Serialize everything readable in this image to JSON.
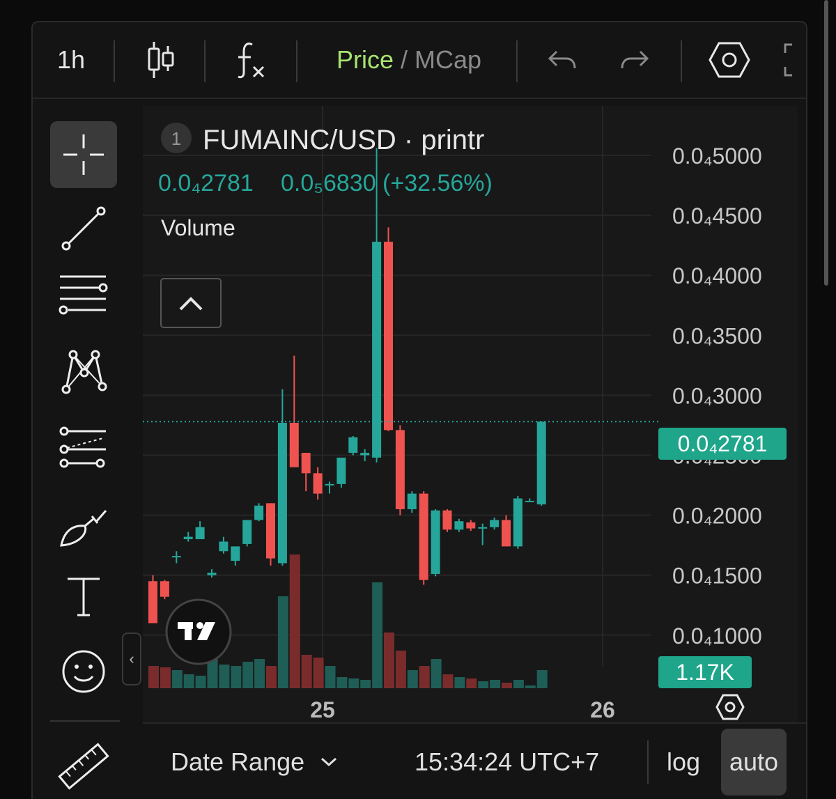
{
  "toolbar": {
    "interval": "1h",
    "price_label": "Price",
    "separator": "/",
    "mcap_label": "MCap",
    "icons": [
      "candles-icon",
      "indicators-fx-icon",
      "undo-icon",
      "redo-icon",
      "settings-hexagon-icon",
      "fullscreen-icon"
    ]
  },
  "left_tools": [
    "crosshair-icon",
    "trend-line-icon",
    "horizontal-lines-icon",
    "pattern-icon",
    "forecast-icon",
    "brush-icon",
    "text-icon",
    "emoji-icon",
    "ruler-icon"
  ],
  "legend": {
    "index": "1",
    "symbol": "FUMAINC/USD · printr",
    "price": "0.0₄2781",
    "change": "0.0₅6830 (+32.56%)",
    "volume_label": "Volume"
  },
  "price_axis": {
    "labels": [
      "0.0₄5000",
      "0.0₄4500",
      "0.0₄4000",
      "0.0₄3500",
      "0.0₄3000",
      "0.0₄2500",
      "0.0₄2000",
      "0.0₄1500",
      "0.0₄1000"
    ],
    "current_price_badge": "0.0₄2781",
    "volume_badge": "1.17K"
  },
  "time_axis": {
    "labels": [
      "25",
      "26"
    ]
  },
  "bottom_bar": {
    "date_range": "Date Range",
    "clock": "15:34:24 UTC+7",
    "log": "log",
    "auto": "auto"
  },
  "colors": {
    "up": "#26a69a",
    "down": "#ef5350",
    "up_vol": "#1f5e56",
    "down_vol": "#7a2c2c",
    "price_label_green": "#a7e46f"
  },
  "chart_data": {
    "type": "candlestick",
    "unit_note": "prices in units of 1e-5 USD (0.0₄2500 = 2.5)",
    "ylim": [
      0.78,
      5.3
    ],
    "candles": [
      {
        "o": 1.45,
        "h": 1.5,
        "l": 1.1,
        "c": 1.1
      },
      {
        "o": 1.45,
        "h": 1.46,
        "l": 1.3,
        "c": 1.32
      },
      {
        "o": 1.66,
        "h": 1.7,
        "l": 1.6,
        "c": 1.66
      },
      {
        "o": 1.8,
        "h": 1.86,
        "l": 1.78,
        "c": 1.82
      },
      {
        "o": 1.8,
        "h": 1.95,
        "l": 1.8,
        "c": 1.9
      },
      {
        "o": 1.5,
        "h": 1.55,
        "l": 1.48,
        "c": 1.52
      },
      {
        "o": 1.7,
        "h": 1.82,
        "l": 1.68,
        "c": 1.78
      },
      {
        "o": 1.62,
        "h": 1.72,
        "l": 1.58,
        "c": 1.74
      },
      {
        "o": 1.76,
        "h": 1.96,
        "l": 1.74,
        "c": 1.96
      },
      {
        "o": 1.96,
        "h": 2.1,
        "l": 1.95,
        "c": 2.08
      },
      {
        "o": 2.1,
        "h": 2.1,
        "l": 1.58,
        "c": 1.64
      },
      {
        "o": 1.6,
        "h": 3.05,
        "l": 1.58,
        "c": 2.77
      },
      {
        "o": 2.77,
        "h": 3.33,
        "l": 2.4,
        "c": 2.4
      },
      {
        "o": 2.52,
        "h": 2.52,
        "l": 2.2,
        "c": 2.35
      },
      {
        "o": 2.35,
        "h": 2.4,
        "l": 2.13,
        "c": 2.18
      },
      {
        "o": 2.26,
        "h": 2.28,
        "l": 2.18,
        "c": 2.26
      },
      {
        "o": 2.26,
        "h": 2.4,
        "l": 2.23,
        "c": 2.48
      },
      {
        "o": 2.52,
        "h": 2.66,
        "l": 2.5,
        "c": 2.65
      },
      {
        "o": 2.5,
        "h": 2.55,
        "l": 2.45,
        "c": 2.52
      },
      {
        "o": 2.48,
        "h": 5.06,
        "l": 2.44,
        "c": 4.28
      },
      {
        "o": 4.28,
        "h": 4.4,
        "l": 2.7,
        "c": 2.71
      },
      {
        "o": 2.71,
        "h": 2.75,
        "l": 2.0,
        "c": 2.05
      },
      {
        "o": 2.05,
        "h": 2.2,
        "l": 2.02,
        "c": 2.18
      },
      {
        "o": 2.18,
        "h": 2.2,
        "l": 1.42,
        "c": 1.46
      },
      {
        "o": 1.51,
        "h": 2.05,
        "l": 1.49,
        "c": 2.04
      },
      {
        "o": 2.04,
        "h": 2.05,
        "l": 1.86,
        "c": 1.88
      },
      {
        "o": 1.88,
        "h": 1.97,
        "l": 1.86,
        "c": 1.95
      },
      {
        "o": 1.94,
        "h": 1.96,
        "l": 1.87,
        "c": 1.89
      },
      {
        "o": 1.89,
        "h": 1.93,
        "l": 1.75,
        "c": 1.9
      },
      {
        "o": 1.9,
        "h": 1.98,
        "l": 1.88,
        "c": 1.96
      },
      {
        "o": 1.96,
        "h": 2.0,
        "l": 1.74,
        "c": 1.74
      },
      {
        "o": 1.74,
        "h": 2.16,
        "l": 1.72,
        "c": 2.14
      },
      {
        "o": 2.12,
        "h": 2.14,
        "l": 2.11,
        "c": 2.12
      },
      {
        "o": 2.09,
        "h": 2.78,
        "l": 2.08,
        "c": 2.78
      }
    ],
    "volumes": [
      0.16,
      0.15,
      0.13,
      0.1,
      0.09,
      0.21,
      0.17,
      0.16,
      0.19,
      0.21,
      0.16,
      0.66,
      0.96,
      0.24,
      0.22,
      0.16,
      0.08,
      0.07,
      0.06,
      0.76,
      0.4,
      0.27,
      0.13,
      0.16,
      0.21,
      0.1,
      0.08,
      0.07,
      0.05,
      0.06,
      0.04,
      0.06,
      0.02,
      0.13
    ],
    "vol_max": 1.0
  }
}
